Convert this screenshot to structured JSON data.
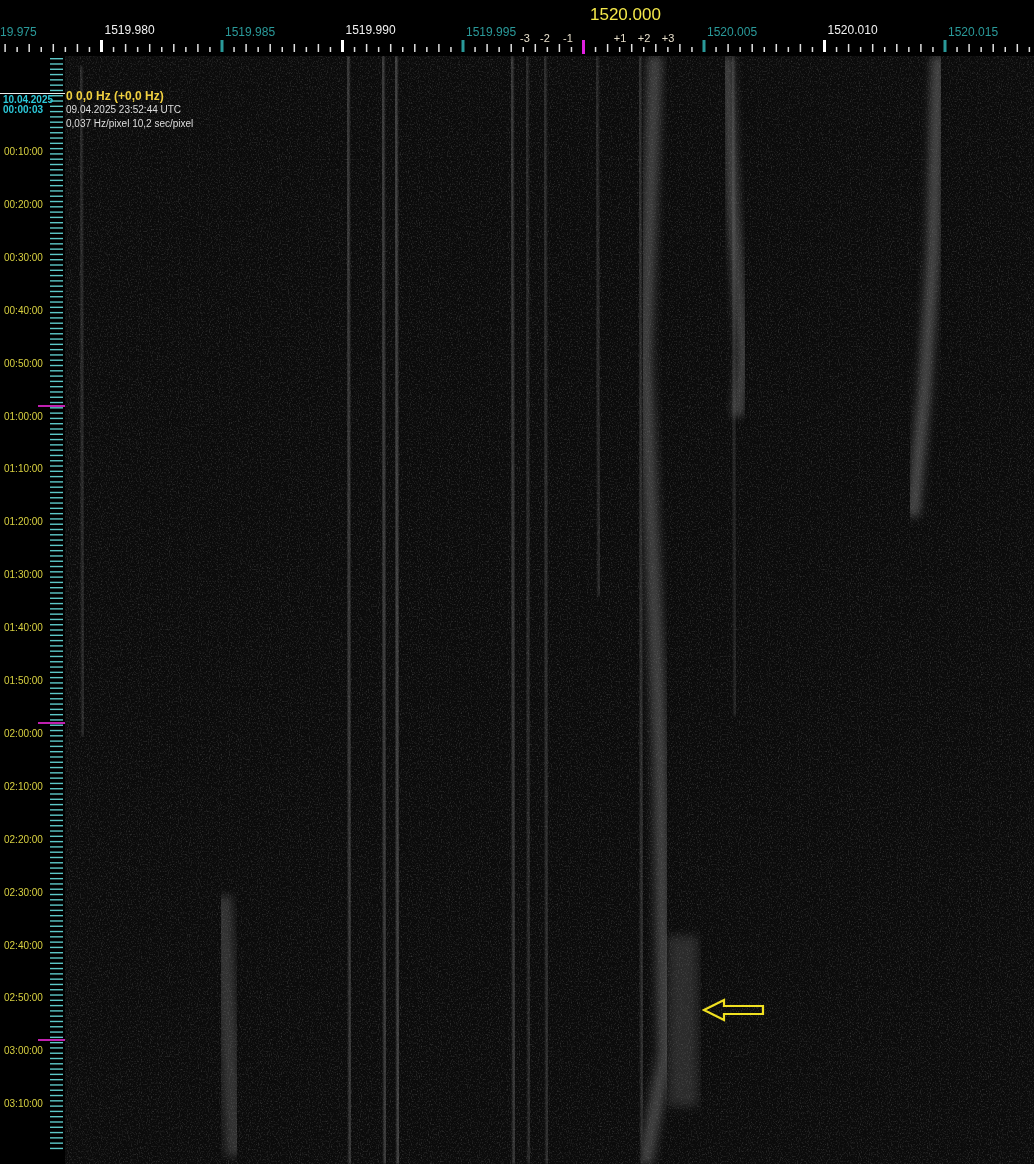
{
  "frequency_axis": {
    "center_label": "1520.000",
    "labels": [
      {
        "text": "19.975",
        "kind": "minor"
      },
      {
        "text": "1519.980",
        "kind": "major"
      },
      {
        "text": "1519.985",
        "kind": "minor"
      },
      {
        "text": "1519.990",
        "kind": "major"
      },
      {
        "text": "1519.995",
        "kind": "minor"
      },
      {
        "text": "1520.005",
        "kind": "minor"
      },
      {
        "text": "1520.010",
        "kind": "major"
      },
      {
        "text": "1520.015",
        "kind": "minor"
      }
    ],
    "offset_labels": [
      "-3",
      "-2",
      "-1",
      "+1",
      "+2",
      "+3"
    ]
  },
  "start": {
    "date": "10.04.2025",
    "time": "00:00:03"
  },
  "readout": {
    "frequency": "0 0,0 Hz (+0,0 Hz)",
    "timestamp": "09.04.2025 23:52:44 UTC",
    "resolution": "0,037 Hz/pixel 10,2 sec/pixel"
  },
  "time_axis": [
    {
      "text": "00:10:00",
      "hour_mark": false
    },
    {
      "text": "00:20:00",
      "hour_mark": false
    },
    {
      "text": "00:30:00",
      "hour_mark": false
    },
    {
      "text": "00:40:00",
      "hour_mark": false
    },
    {
      "text": "00:50:00",
      "hour_mark": false
    },
    {
      "text": "01:00:00",
      "hour_mark": true
    },
    {
      "text": "01:10:00",
      "hour_mark": false
    },
    {
      "text": "01:20:00",
      "hour_mark": false
    },
    {
      "text": "01:30:00",
      "hour_mark": false
    },
    {
      "text": "01:40:00",
      "hour_mark": false
    },
    {
      "text": "01:50:00",
      "hour_mark": false
    },
    {
      "text": "02:00:00",
      "hour_mark": true
    },
    {
      "text": "02:10:00",
      "hour_mark": false
    },
    {
      "text": "02:20:00",
      "hour_mark": false
    },
    {
      "text": "02:30:00",
      "hour_mark": false
    },
    {
      "text": "02:40:00",
      "hour_mark": false
    },
    {
      "text": "02:50:00",
      "hour_mark": false
    },
    {
      "text": "03:00:00",
      "hour_mark": true
    },
    {
      "text": "03:10:00",
      "hour_mark": false
    }
  ]
}
